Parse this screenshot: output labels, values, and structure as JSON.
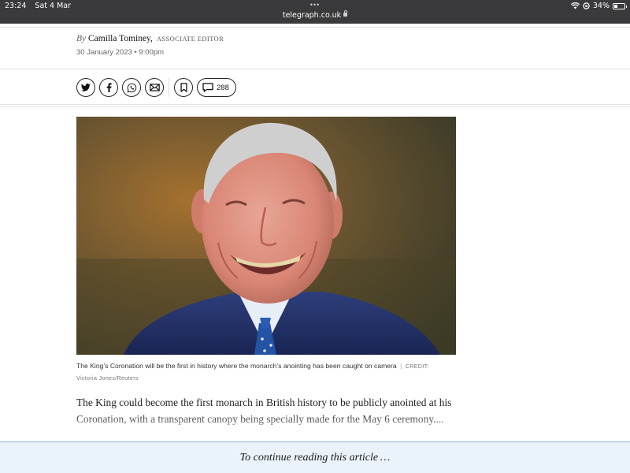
{
  "status_bar": {
    "time": "23:24",
    "date": "Sat 4 Mar",
    "url": "telegraph.co.uk",
    "battery": "34%",
    "battery_level": 0.34,
    "icons": [
      "wifi-icon",
      "orientation-lock-icon",
      "battery-icon",
      "lock-icon"
    ]
  },
  "byline": {
    "by": "By",
    "author": "Camilla Tominey,",
    "role": "ASSOCIATE EDITOR",
    "published": "30 January 2023 • 9:00pm"
  },
  "share": {
    "icons": [
      "twitter-icon",
      "facebook-icon",
      "whatsapp-icon",
      "email-icon",
      "bookmark-icon",
      "comment-icon"
    ],
    "comment_count": "288"
  },
  "hero": {
    "caption": "The King’s Coronation will be the first in history where the monarch’s anointing has been caught on camera",
    "credit_label": "CREDIT:",
    "credit": "Victoria Jones/Reuters"
  },
  "article": {
    "lead": "The King could become the first monarch in British history to be publicly anointed at his Coronation, with a transparent canopy being specially made for the May 6 ceremony...."
  },
  "paywall": {
    "text": "To continue reading this article …"
  },
  "colors": {
    "status_bar": "#3a3a3c",
    "paywall_bg": "#eaf3fa",
    "paywall_border": "#8ab6d8"
  }
}
